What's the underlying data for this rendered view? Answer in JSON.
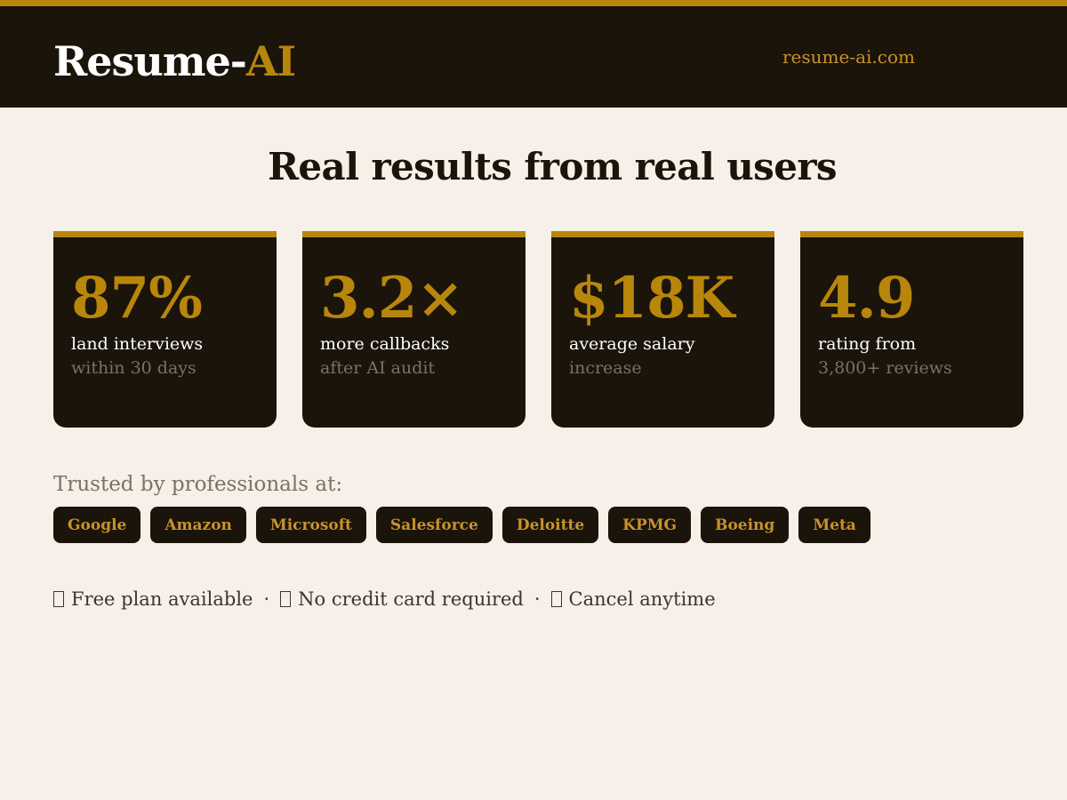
{
  "brand": {
    "name_main": "Resume-",
    "name_accent": "AI",
    "domain": "resume-ai.com"
  },
  "headline": "Real results from real users",
  "stats": [
    {
      "value": "87%",
      "label": "land interviews",
      "sub": "within 30 days"
    },
    {
      "value": "3.2×",
      "label": "more callbacks",
      "sub": "after AI audit"
    },
    {
      "value": "$18K",
      "label": "average salary",
      "sub": "increase"
    },
    {
      "value": "4.9",
      "label": "rating from",
      "sub": "3,800+ reviews"
    }
  ],
  "trusted": {
    "label": "Trusted by professionals at:",
    "companies": [
      "Google",
      "Amazon",
      "Microsoft",
      "Salesforce",
      "Deloitte",
      "KPMG",
      "Boeing",
      "Meta"
    ]
  },
  "perks": {
    "items": [
      "Free plan available",
      "No credit card required",
      "Cancel anytime"
    ],
    "separator": "·",
    "icon": "check-icon"
  },
  "colors": {
    "accent": "#b8860b",
    "dark": "#1a140b",
    "background": "#f6f0e8",
    "muted": "#7a7266"
  }
}
